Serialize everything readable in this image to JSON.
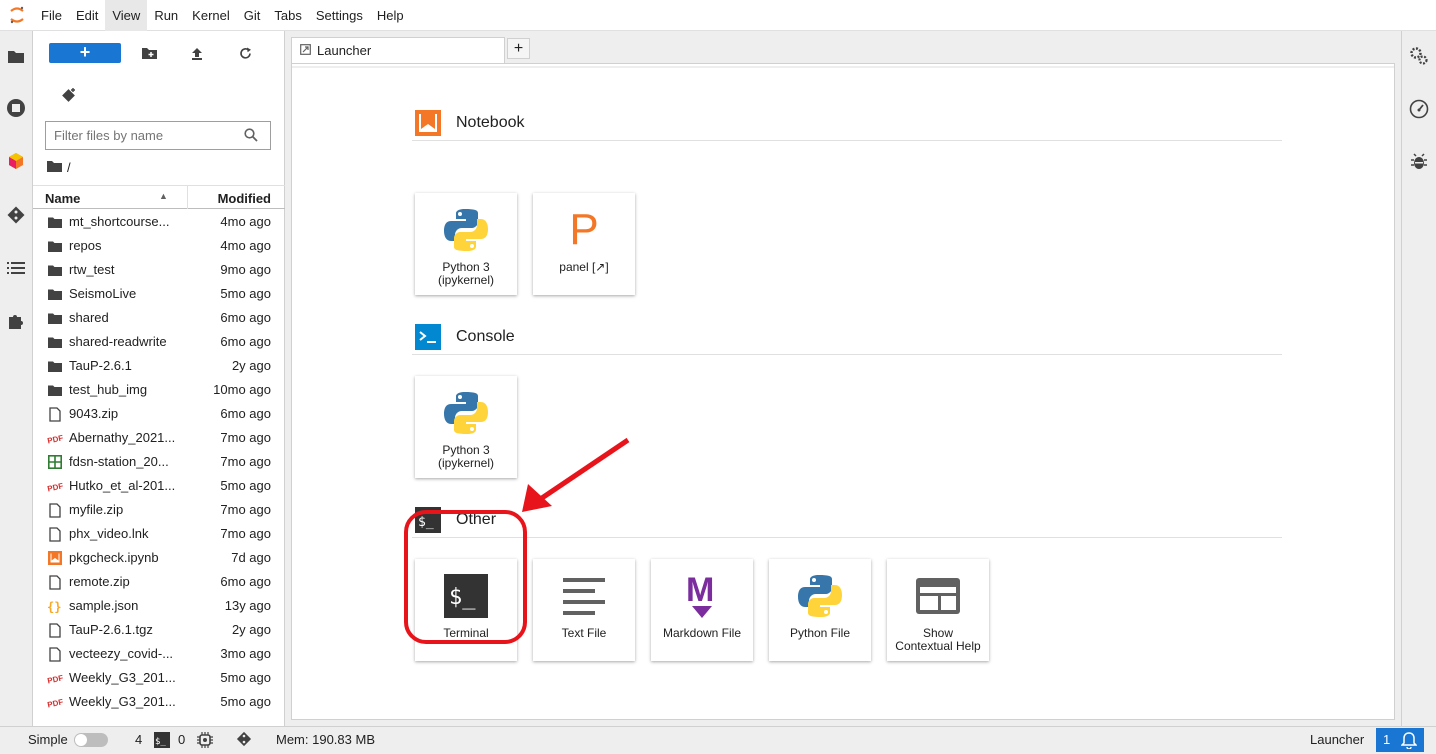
{
  "menubar": {
    "items": [
      "File",
      "Edit",
      "View",
      "Run",
      "Kernel",
      "Git",
      "Tabs",
      "Settings",
      "Help"
    ],
    "active": "View"
  },
  "filebrowser": {
    "filter_placeholder": "Filter files by name",
    "breadcrumb": "/",
    "col_name": "Name",
    "col_modified": "Modified",
    "files": [
      {
        "name": "mt_shortcourse...",
        "modified": "4mo ago",
        "icon": "folder-icon"
      },
      {
        "name": "repos",
        "modified": "4mo ago",
        "icon": "folder-icon"
      },
      {
        "name": "rtw_test",
        "modified": "9mo ago",
        "icon": "folder-icon"
      },
      {
        "name": "SeismoLive",
        "modified": "5mo ago",
        "icon": "folder-icon"
      },
      {
        "name": "shared",
        "modified": "6mo ago",
        "icon": "folder-icon"
      },
      {
        "name": "shared-readwrite",
        "modified": "6mo ago",
        "icon": "folder-icon"
      },
      {
        "name": "TauP-2.6.1",
        "modified": "2y ago",
        "icon": "folder-icon"
      },
      {
        "name": "test_hub_img",
        "modified": "10mo ago",
        "icon": "folder-icon"
      },
      {
        "name": "9043.zip",
        "modified": "6mo ago",
        "icon": "file-icon"
      },
      {
        "name": "Abernathy_2021...",
        "modified": "7mo ago",
        "icon": "pdf-icon"
      },
      {
        "name": "fdsn-station_20...",
        "modified": "7mo ago",
        "icon": "spreadsheet-icon"
      },
      {
        "name": "Hutko_et_al-201...",
        "modified": "5mo ago",
        "icon": "pdf-icon"
      },
      {
        "name": "myfile.zip",
        "modified": "7mo ago",
        "icon": "file-icon"
      },
      {
        "name": "phx_video.lnk",
        "modified": "7mo ago",
        "icon": "file-icon"
      },
      {
        "name": "pkgcheck.ipynb",
        "modified": "7d ago",
        "icon": "notebook-icon"
      },
      {
        "name": "remote.zip",
        "modified": "6mo ago",
        "icon": "file-icon"
      },
      {
        "name": "sample.json",
        "modified": "13y ago",
        "icon": "json-icon"
      },
      {
        "name": "TauP-2.6.1.tgz",
        "modified": "2y ago",
        "icon": "file-icon"
      },
      {
        "name": "vecteezy_covid-...",
        "modified": "3mo ago",
        "icon": "file-icon"
      },
      {
        "name": "Weekly_G3_201...",
        "modified": "5mo ago",
        "icon": "pdf-icon"
      },
      {
        "name": "Weekly_G3_201...",
        "modified": "5mo ago",
        "icon": "pdf-icon"
      }
    ]
  },
  "tabs": {
    "launcher_label": "Launcher",
    "add_label": "+"
  },
  "launcher": {
    "sections": {
      "notebook": {
        "title": "Notebook",
        "cards": [
          {
            "label_line1": "Python 3",
            "label_line2": "(ipykernel)"
          },
          {
            "label_line1": "panel [↗]",
            "label_line2": ""
          }
        ]
      },
      "console": {
        "title": "Console",
        "cards": [
          {
            "label_line1": "Python 3",
            "label_line2": "(ipykernel)"
          }
        ]
      },
      "other": {
        "title": "Other",
        "cards": [
          {
            "label_line1": "Terminal",
            "label_line2": ""
          },
          {
            "label_line1": "Text File",
            "label_line2": ""
          },
          {
            "label_line1": "Markdown File",
            "label_line2": ""
          },
          {
            "label_line1": "Python File",
            "label_line2": ""
          },
          {
            "label_line1": "Show",
            "label_line2": "Contextual Help"
          }
        ]
      }
    },
    "panel_glyph": "P",
    "terminal_glyph": "$_",
    "console_glyph": ">_",
    "markdown_glyph": "M"
  },
  "statusbar": {
    "mode_label": "Simple",
    "terminals_count": "4",
    "terminal_glyph": "$_",
    "kernels_count": "0",
    "memory": "Mem: 190.83 MB",
    "right_label": "Launcher",
    "notifications_count": "1"
  },
  "colors": {
    "accent": "#1976d2",
    "notebook_orange": "#f37726",
    "annotation_red": "#e8141b",
    "markdown_purple": "#7b2d9e"
  }
}
